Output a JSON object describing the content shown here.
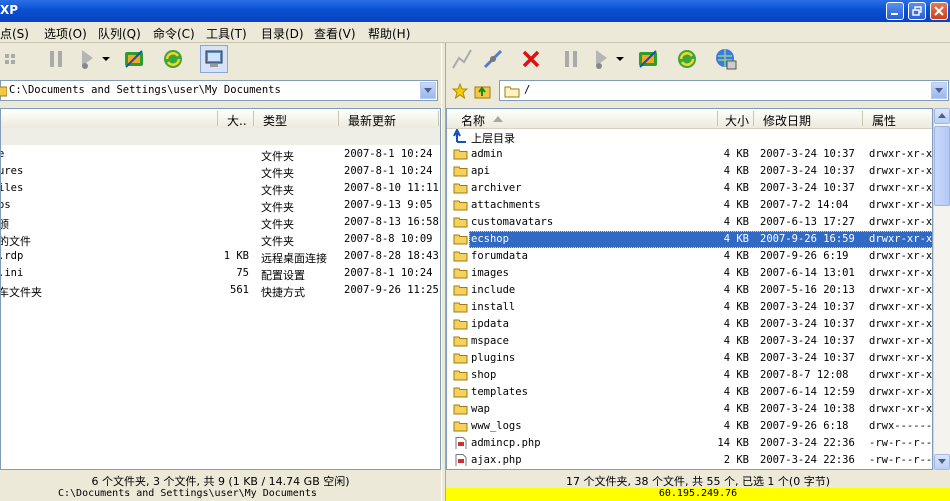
{
  "window": {
    "title": "XP"
  },
  "menu": [
    "点(S)",
    "选项(O)",
    "队列(Q)",
    "命令(C)",
    "工具(T)",
    "目录(D)",
    "查看(V)",
    "帮助(H)"
  ],
  "left": {
    "address": "C:\\Documents and Settings\\user\\My Documents",
    "headers": {
      "name": "",
      "size": "大..",
      "type": "类型",
      "modified": "最新更新"
    },
    "rows": [
      {
        "name": "",
        "size": "",
        "type": "",
        "modified": ""
      },
      {
        "name": "e",
        "size": "",
        "type": "文件夹",
        "modified": "2007-8-1 10:24"
      },
      {
        "name": "ures",
        "size": "",
        "type": "文件夹",
        "modified": "2007-8-1 10:24"
      },
      {
        "name": "iles",
        "size": "",
        "type": "文件夹",
        "modified": "2007-8-10 11:11"
      },
      {
        "name": "os",
        "size": "",
        "type": "文件夹",
        "modified": "2007-9-13 9:05"
      },
      {
        "name": "颁",
        "size": "",
        "type": "文件夹",
        "modified": "2007-8-13 16:58"
      },
      {
        "name": "的文件",
        "size": "",
        "type": "文件夹",
        "modified": "2007-8-8 10:09"
      },
      {
        "name": ".rdp",
        "size": "1 KB",
        "type": "远程桌面连接",
        "modified": "2007-8-28 18:43"
      },
      {
        "name": ".ini",
        "size": "75",
        "type": "配置设置",
        "modified": "2007-8-1 10:24"
      },
      {
        "name": "车文件夹",
        "size": "561",
        "type": "快捷方式",
        "modified": "2007-9-26 11:25"
      }
    ],
    "status": "6 个文件夹, 3 个文件, 共 9 (1 KB / 14.74 GB 空闲)",
    "path": "C:\\Documents and Settings\\user\\My Documents"
  },
  "right": {
    "address": "/",
    "headers": {
      "name": "名称",
      "size": "大小",
      "modified": "修改日期",
      "attr": "属性"
    },
    "up_label": "上层目录",
    "rows": [
      {
        "name": "admin",
        "size": "4 KB",
        "modified": "2007-3-24 10:37",
        "attr": "drwxr-xr-x",
        "kind": "folder"
      },
      {
        "name": "api",
        "size": "4 KB",
        "modified": "2007-3-24 10:37",
        "attr": "drwxr-xr-x",
        "kind": "folder"
      },
      {
        "name": "archiver",
        "size": "4 KB",
        "modified": "2007-3-24 10:37",
        "attr": "drwxr-xr-x",
        "kind": "folder"
      },
      {
        "name": "attachments",
        "size": "4 KB",
        "modified": "2007-7-2 14:04",
        "attr": "drwxr-xr-x",
        "kind": "folder"
      },
      {
        "name": "customavatars",
        "size": "4 KB",
        "modified": "2007-6-13 17:27",
        "attr": "drwxr-xr-x",
        "kind": "folder"
      },
      {
        "name": "ecshop",
        "size": "4 KB",
        "modified": "2007-9-26 16:59",
        "attr": "drwxr-xr-x",
        "kind": "folder",
        "selected": true
      },
      {
        "name": "forumdata",
        "size": "4 KB",
        "modified": "2007-9-26 6:19",
        "attr": "drwxr-xr-x",
        "kind": "folder"
      },
      {
        "name": "images",
        "size": "4 KB",
        "modified": "2007-6-14 13:01",
        "attr": "drwxr-xr-x",
        "kind": "folder"
      },
      {
        "name": "include",
        "size": "4 KB",
        "modified": "2007-5-16 20:13",
        "attr": "drwxr-xr-x",
        "kind": "folder"
      },
      {
        "name": "install",
        "size": "4 KB",
        "modified": "2007-3-24 10:37",
        "attr": "drwxr-xr-x",
        "kind": "folder"
      },
      {
        "name": "ipdata",
        "size": "4 KB",
        "modified": "2007-3-24 10:37",
        "attr": "drwxr-xr-x",
        "kind": "folder"
      },
      {
        "name": "mspace",
        "size": "4 KB",
        "modified": "2007-3-24 10:37",
        "attr": "drwxr-xr-x",
        "kind": "folder"
      },
      {
        "name": "plugins",
        "size": "4 KB",
        "modified": "2007-3-24 10:37",
        "attr": "drwxr-xr-x",
        "kind": "folder"
      },
      {
        "name": "shop",
        "size": "4 KB",
        "modified": "2007-8-7 12:08",
        "attr": "drwxr-xr-x",
        "kind": "folder"
      },
      {
        "name": "templates",
        "size": "4 KB",
        "modified": "2007-6-14 12:59",
        "attr": "drwxr-xr-x",
        "kind": "folder"
      },
      {
        "name": "wap",
        "size": "4 KB",
        "modified": "2007-3-24 10:38",
        "attr": "drwxr-xr-x",
        "kind": "folder"
      },
      {
        "name": "www_logs",
        "size": "4 KB",
        "modified": "2007-9-26 6:18",
        "attr": "drwx------",
        "kind": "folder"
      },
      {
        "name": "admincp.php",
        "size": "14 KB",
        "modified": "2007-3-24 22:36",
        "attr": "-rw-r--r--",
        "kind": "file"
      },
      {
        "name": "ajax.php",
        "size": "2 KB",
        "modified": "2007-3-24 22:36",
        "attr": "-rw-r--r--",
        "kind": "file"
      }
    ],
    "status": "17 个文件夹, 38 个文件, 共 55 个, 已选 1 个(0 字节)",
    "host": "60.195.249.76",
    "host_bg": "#ffff00"
  }
}
